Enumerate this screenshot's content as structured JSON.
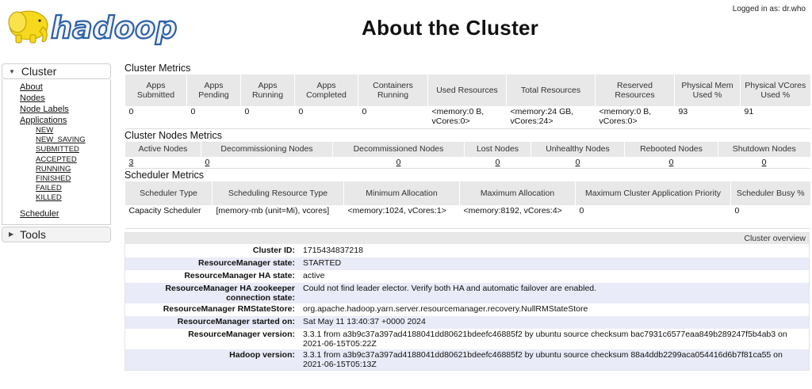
{
  "header": {
    "logo_text": "hadoop",
    "title": "About the Cluster",
    "login": "Logged in as: dr.who"
  },
  "sidebar": {
    "cluster_label": "Cluster",
    "cluster_links": [
      "About",
      "Nodes",
      "Node Labels",
      "Applications"
    ],
    "app_states": [
      "NEW",
      "NEW_SAVING",
      "SUBMITTED",
      "ACCEPTED",
      "RUNNING",
      "FINISHED",
      "FAILED",
      "KILLED"
    ],
    "scheduler": "Scheduler",
    "tools_label": "Tools"
  },
  "cluster_metrics": {
    "title": "Cluster Metrics",
    "headers": [
      "Apps Submitted",
      "Apps Pending",
      "Apps Running",
      "Apps Completed",
      "Containers Running",
      "Used Resources",
      "Total Resources",
      "Reserved Resources",
      "Physical Mem Used %",
      "Physical VCores Used %"
    ],
    "values": [
      "0",
      "0",
      "0",
      "0",
      "0",
      "<memory:0 B, vCores:0>",
      "<memory:24 GB, vCores:24>",
      "<memory:0 B, vCores:0>",
      "93",
      "91"
    ]
  },
  "node_metrics": {
    "title": "Cluster Nodes Metrics",
    "headers": [
      "Active Nodes",
      "Decommissioning Nodes",
      "Decommissioned Nodes",
      "Lost Nodes",
      "Unhealthy Nodes",
      "Rebooted Nodes",
      "Shutdown Nodes"
    ],
    "values": [
      "3",
      "0",
      "0",
      "0",
      "0",
      "0",
      "0"
    ]
  },
  "scheduler_metrics": {
    "title": "Scheduler Metrics",
    "headers": [
      "Scheduler Type",
      "Scheduling Resource Type",
      "Minimum Allocation",
      "Maximum Allocation",
      "Maximum Cluster Application Priority",
      "Scheduler Busy %"
    ],
    "values": [
      "Capacity Scheduler",
      "[memory-mb (unit=Mi), vcores]",
      "<memory:1024, vCores:1>",
      "<memory:8192, vCores:4>",
      "0",
      "0"
    ]
  },
  "overview": {
    "title": "Cluster overview",
    "rows": [
      {
        "label": "Cluster ID:",
        "value": "1715434837218"
      },
      {
        "label": "ResourceManager state:",
        "value": "STARTED"
      },
      {
        "label": "ResourceManager HA state:",
        "value": "active"
      },
      {
        "label": "ResourceManager HA zookeeper connection state:",
        "value": "Could not find leader elector. Verify both HA and automatic failover are enabled."
      },
      {
        "label": "ResourceManager RMStateStore:",
        "value": "org.apache.hadoop.yarn.server.resourcemanager.recovery.NullRMStateStore"
      },
      {
        "label": "ResourceManager started on:",
        "value": "Sat May 11 13:40:37 +0000 2024"
      },
      {
        "label": "ResourceManager version:",
        "value": "3.3.1 from a3b9c37a397ad4188041dd80621bdeefc46885f2 by ubuntu source checksum bac7931c6577eaa849b289247f5b4ab3 on 2021-06-15T05:22Z"
      },
      {
        "label": "Hadoop version:",
        "value": "3.3.1 from a3b9c37a397ad4188041dd80621bdeefc46885f2 by ubuntu source checksum 88a4ddb2299aca054416d6b7f81ca55 on 2021-06-15T05:13Z"
      }
    ]
  },
  "colors": {
    "header_bg": "#e8e8e8",
    "info_stripe": "#e9ebf9",
    "logo_yellow": "#f6d81c",
    "logo_blue": "#2a5fa8"
  }
}
